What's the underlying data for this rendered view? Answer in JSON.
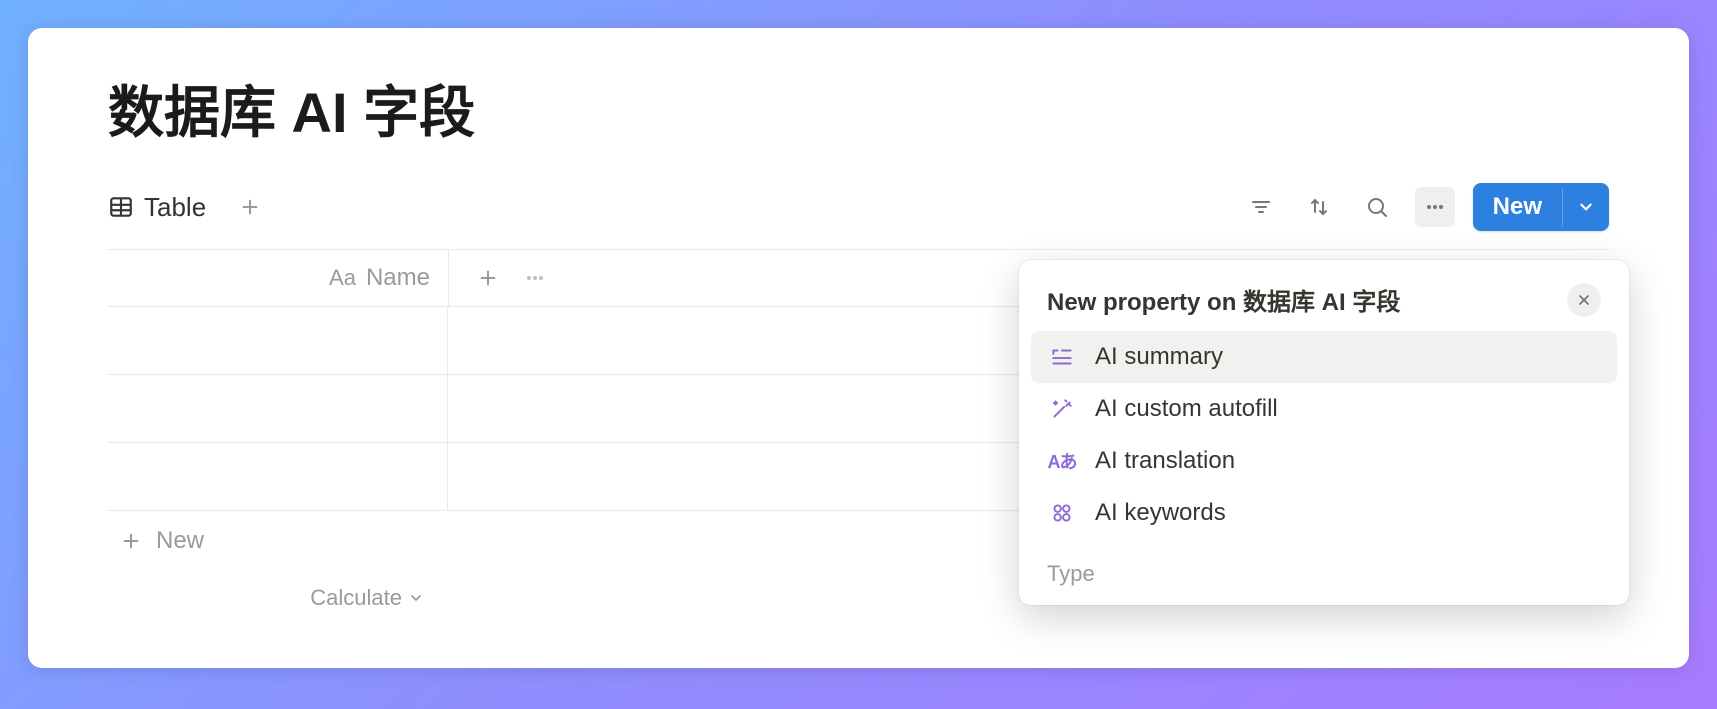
{
  "page": {
    "title": "数据库 AI 字段"
  },
  "toolbar": {
    "view_label": "Table",
    "new_label": "New"
  },
  "columns": {
    "name_label": "Name"
  },
  "footer": {
    "new_row_label": "New",
    "calc_label": "Calculate"
  },
  "panel": {
    "title": "New property on 数据库 AI 字段",
    "items": [
      {
        "label": "AI summary"
      },
      {
        "label": "AI custom autofill"
      },
      {
        "label": "AI translation"
      },
      {
        "label": "AI keywords"
      }
    ],
    "section_label": "Type"
  }
}
